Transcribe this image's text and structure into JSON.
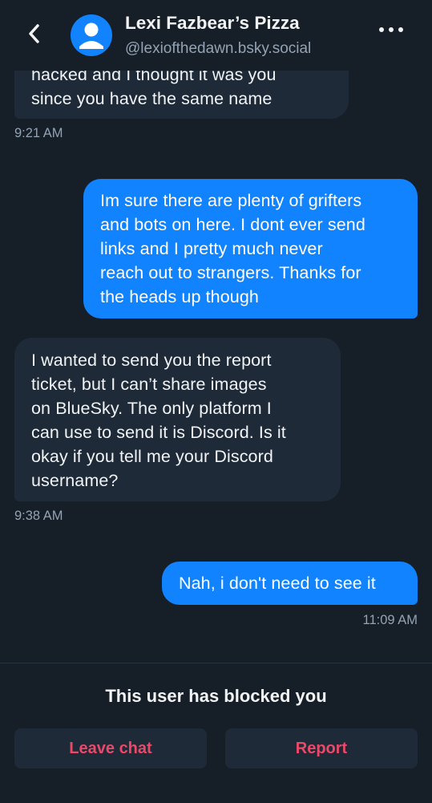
{
  "header": {
    "back_icon": "chevron-left-icon",
    "title": "Lexi Fazbear’s Pizza",
    "handle": "@lexiofthedawn.bsky.social",
    "more_icon": "more-horizontal-icon"
  },
  "messages": [
    {
      "direction": "incoming",
      "text": "hacked and I thought it was you\nsince you have the same name",
      "time": "9:21 AM"
    },
    {
      "direction": "outgoing",
      "text": "Im sure there are plenty of grifters\nand bots on here. I dont ever send\nlinks and I pretty much never\nreach out to strangers. Thanks for\nthe heads up though",
      "time": ""
    },
    {
      "direction": "incoming",
      "text": "I wanted to send you the report\nticket, but I can’t share images\non BlueSky. The only platform I\ncan use to send it is Discord. Is it\nokay if you tell me your Discord\nusername?",
      "time": "9:38 AM"
    },
    {
      "direction": "outgoing",
      "text": "Nah, i don't need to see it",
      "time": "11:09 AM"
    }
  ],
  "footer": {
    "blocked_text": "This user has blocked you",
    "leave_label": "Leave chat",
    "report_label": "Report"
  },
  "colors": {
    "background": "#161e27",
    "incoming_bubble": "#1e2a38",
    "outgoing_bubble": "#1183fe",
    "danger": "#ec4868"
  }
}
